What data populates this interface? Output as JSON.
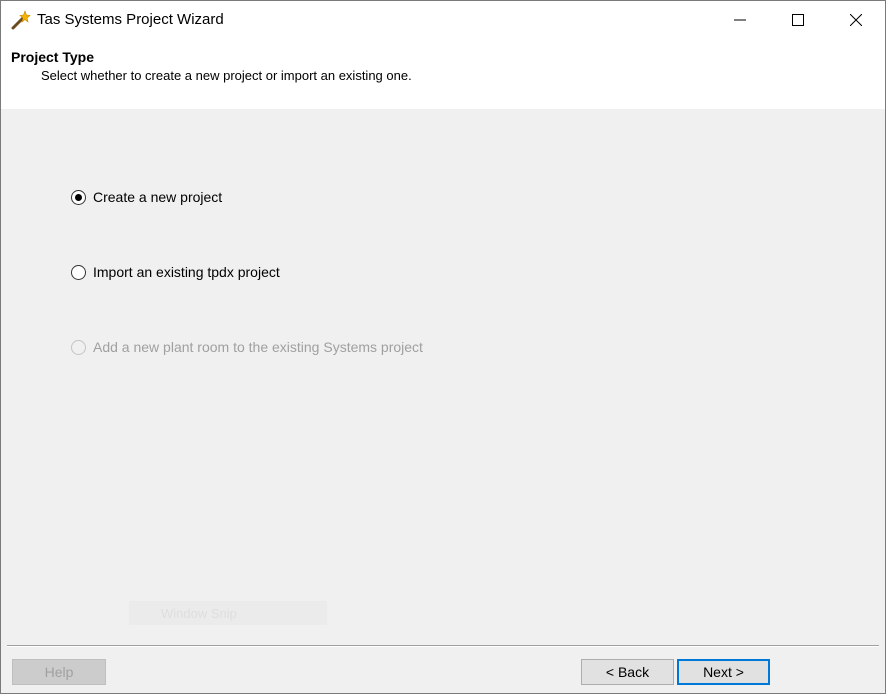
{
  "window": {
    "title": "Tas Systems Project Wizard",
    "controls": [
      "minimize-icon",
      "maximize-icon",
      "close-icon"
    ]
  },
  "header": {
    "title": "Project Type",
    "subtitle": "Select whether to create a new project or import an existing one."
  },
  "options": [
    {
      "label": "Create a new project",
      "checked": true,
      "enabled": true
    },
    {
      "label": "Import an existing tpdx project",
      "checked": false,
      "enabled": true
    },
    {
      "label": "Add a new plant room to the existing Systems project",
      "checked": false,
      "enabled": false
    }
  ],
  "ghost_text": "Window Snip",
  "buttons": {
    "help": "Help",
    "back": "< Back",
    "next": "Next >"
  },
  "colors": {
    "accent": "#0078d7",
    "disabled_text": "#a0a0a0"
  }
}
